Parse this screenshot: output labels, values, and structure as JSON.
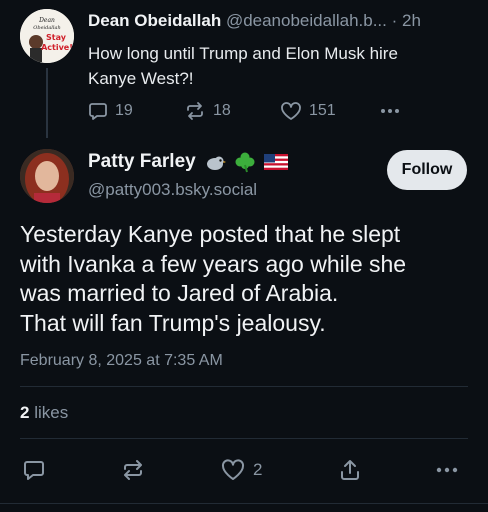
{
  "parent_post": {
    "author_name": "Dean Obeidallah",
    "handle": "@deanobeidallah.b...",
    "separator": "·",
    "time_ago": "2h",
    "text_line1": "How long until Trump and Elon Musk hire",
    "text_line2": "Kanye West?!",
    "replies": "19",
    "reposts": "18",
    "likes": "151",
    "avatar_text": [
      "Dean",
      "Obeidallah",
      "Stay",
      "Active!"
    ]
  },
  "main_post": {
    "author_name": "Patty Farley",
    "name_emojis": [
      "bird-emoji",
      "shamrock-emoji",
      "us-flag-emoji"
    ],
    "handle": "@patty003.bsky.social",
    "follow_label": "Follow",
    "text_lines": [
      "Yesterday Kanye posted that he slept",
      "with Ivanka a few years ago while she",
      "was married to Jared of Arabia.",
      "That will fan Trump's jealousy."
    ],
    "timestamp": "February 8, 2025 at 7:35 AM",
    "likes_count": "2",
    "likes_label": "likes",
    "like_action_count": "2"
  },
  "colors": {
    "background": "#0b0f14",
    "text": "#f1f3f5",
    "muted": "#8a96a3",
    "divider": "#222b35",
    "follow_bg": "#e4e8ec"
  }
}
